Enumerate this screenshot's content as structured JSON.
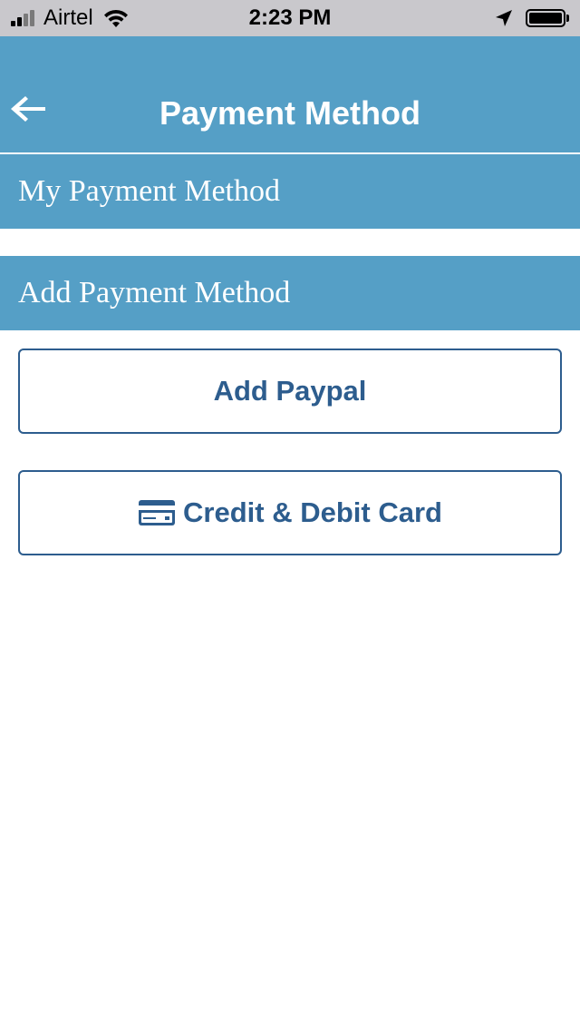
{
  "status_bar": {
    "carrier": "Airtel",
    "time": "2:23 PM",
    "signal_icon": "signal-bars-icon",
    "wifi_icon": "wifi-icon",
    "location_icon": "location-arrow-icon",
    "battery_icon": "battery-icon"
  },
  "header": {
    "title": "Payment Method",
    "back_icon": "back-arrow-icon",
    "background_color": "#559fc6"
  },
  "sections": {
    "my_payment_method": "My Payment Method",
    "add_payment_method": "Add Payment Method"
  },
  "buttons": {
    "add_paypal": "Add Paypal",
    "credit_debit_card": "Credit & Debit Card",
    "card_icon": "credit-card-icon",
    "border_color": "#2d5d8e"
  }
}
